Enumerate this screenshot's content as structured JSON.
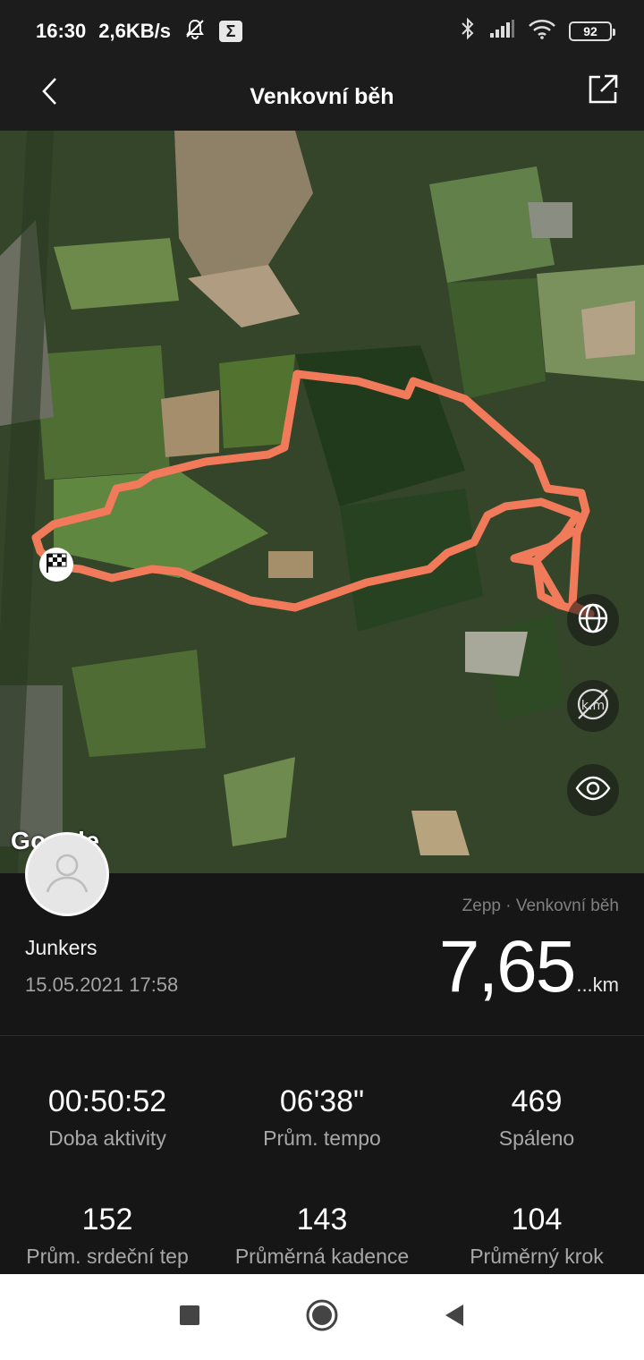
{
  "status_bar": {
    "time": "16:30",
    "speed": "2,6KB/s",
    "sigma": "Σ",
    "battery": "92"
  },
  "app_bar": {
    "title": "Venkovní běh",
    "back_icon": "chevron-left-icon",
    "share_icon": "share-external-icon"
  },
  "map": {
    "attribution": "Google",
    "route_color": "#f07a5a",
    "buttons": [
      "globe-icon",
      "km-marker-off-icon",
      "eye-icon"
    ]
  },
  "summary": {
    "user_name": "Junkers",
    "date": "15.05.2021 17:58",
    "source": "Zepp · Venkovní běh",
    "distance_value": "7,65",
    "distance_unit": "...km"
  },
  "stats": [
    {
      "value": "00:50:52",
      "label": "Doba aktivity"
    },
    {
      "value": "06'38\"",
      "label": "Prům. tempo"
    },
    {
      "value": "469",
      "label": "Spáleno"
    },
    {
      "value": "152",
      "label": "Prům. srdeční tep"
    },
    {
      "value": "143",
      "label": "Průměrná kadence"
    },
    {
      "value": "104",
      "label": "Průměrný krok"
    }
  ],
  "nav": {
    "recents_icon": "square-icon",
    "home_icon": "circle-icon",
    "back_icon": "triangle-back-icon"
  }
}
